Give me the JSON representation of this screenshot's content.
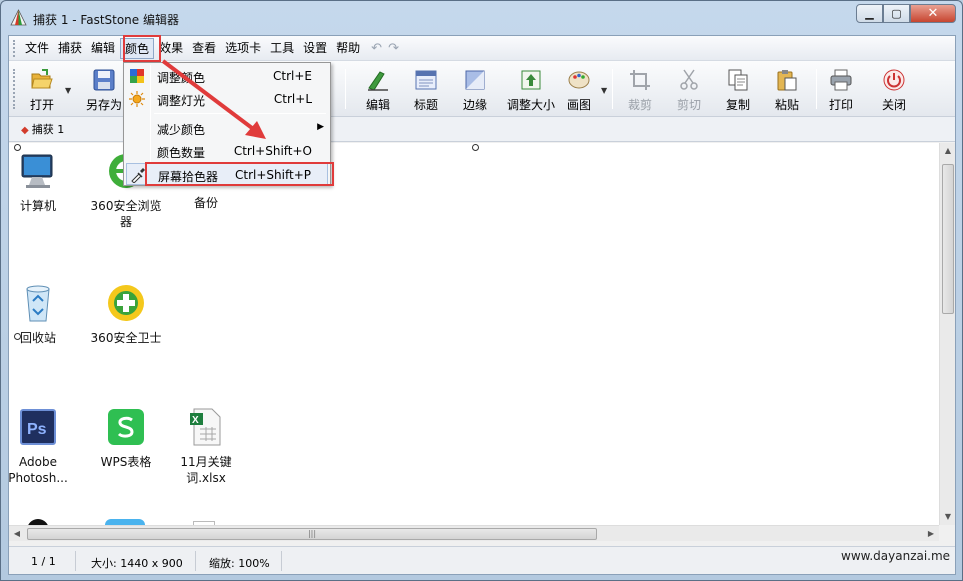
{
  "window": {
    "title": "捕获 1 - FastStone 编辑器",
    "min_label": "▁",
    "max_label": "▢",
    "close_label": "✕"
  },
  "menubar": {
    "items": [
      "文件",
      "捕获",
      "编辑",
      "颜色",
      "效果",
      "查看",
      "选项卡",
      "工具",
      "设置",
      "帮助"
    ],
    "undo_label": "↶",
    "redo_label": "↷"
  },
  "toolbar": {
    "open": "打开",
    "save_as": "另存为",
    "edit": "编辑",
    "caption": "标题",
    "edge": "边缘",
    "resize": "调整大小",
    "draw": "画图",
    "crop": "裁剪",
    "cut": "剪切",
    "copy": "复制",
    "paste": "粘贴",
    "print": "打印",
    "close": "关闭"
  },
  "tabs": [
    {
      "label": "捕获 1"
    }
  ],
  "color_menu": {
    "items": [
      {
        "label": "调整颜色",
        "shortcut": "Ctrl+E"
      },
      {
        "label": "调整灯光",
        "shortcut": "Ctrl+L"
      },
      {
        "label": "减少颜色",
        "shortcut": ""
      },
      {
        "label": "颜色数量",
        "shortcut": "Ctrl+Shift+O"
      },
      {
        "label": "屏幕拾色器",
        "shortcut": "Ctrl+Shift+P"
      }
    ],
    "submenu_arrow": "▶"
  },
  "desktop_icons": [
    {
      "label": "计算机"
    },
    {
      "label": "360安全浏览器"
    },
    {
      "label": "备份"
    },
    {
      "label": "回收站"
    },
    {
      "label": "360安全卫士"
    },
    {
      "label": "Adobe Photosh..."
    },
    {
      "label": "WPS表格"
    },
    {
      "label": "11月关键词.xlsx"
    }
  ],
  "statusbar": {
    "page": "1 / 1",
    "size": "大小: 1440 x 900",
    "zoom": "缩放: 100%",
    "site": "www.dayanzai.me"
  },
  "colors": {
    "highlight": "#e03b3b",
    "window_frame": "#c5d8ec"
  }
}
